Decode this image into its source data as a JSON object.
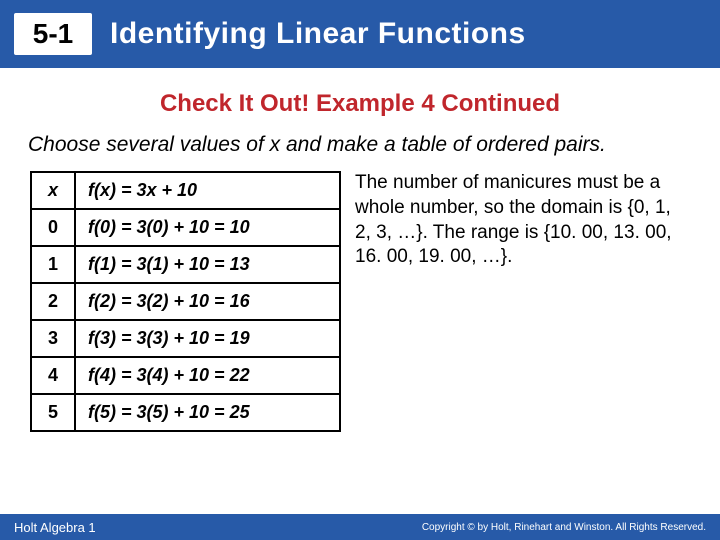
{
  "header": {
    "badge": "5-1",
    "title": "Identifying Linear Functions"
  },
  "subtitle": "Check It Out! Example 4 Continued",
  "instruction": "Choose several values of x and make a table of ordered pairs.",
  "table": {
    "header": {
      "x": "x",
      "fx": "f(x) = 3x + 10"
    },
    "rows": [
      {
        "x": "0",
        "f": "f(0) = 3(0) + 10 = 10"
      },
      {
        "x": "1",
        "f": "f(1) = 3(1) + 10 = 13"
      },
      {
        "x": "2",
        "f": "f(2) = 3(2) + 10 = 16"
      },
      {
        "x": "3",
        "f": "f(3) = 3(3) + 10 = 19"
      },
      {
        "x": "4",
        "f": "f(4) = 3(4) + 10 = 22"
      },
      {
        "x": "5",
        "f": "f(5) = 3(5) + 10 = 25"
      }
    ]
  },
  "explain": "The number of manicures must be a whole number, so the domain is {0, 1, 2, 3, …}. The range is {10. 00, 13. 00, 16. 00, 19. 00, …}.",
  "footer": {
    "left": "Holt Algebra 1",
    "right": "Copyright © by Holt, Rinehart and Winston. All Rights Reserved."
  }
}
